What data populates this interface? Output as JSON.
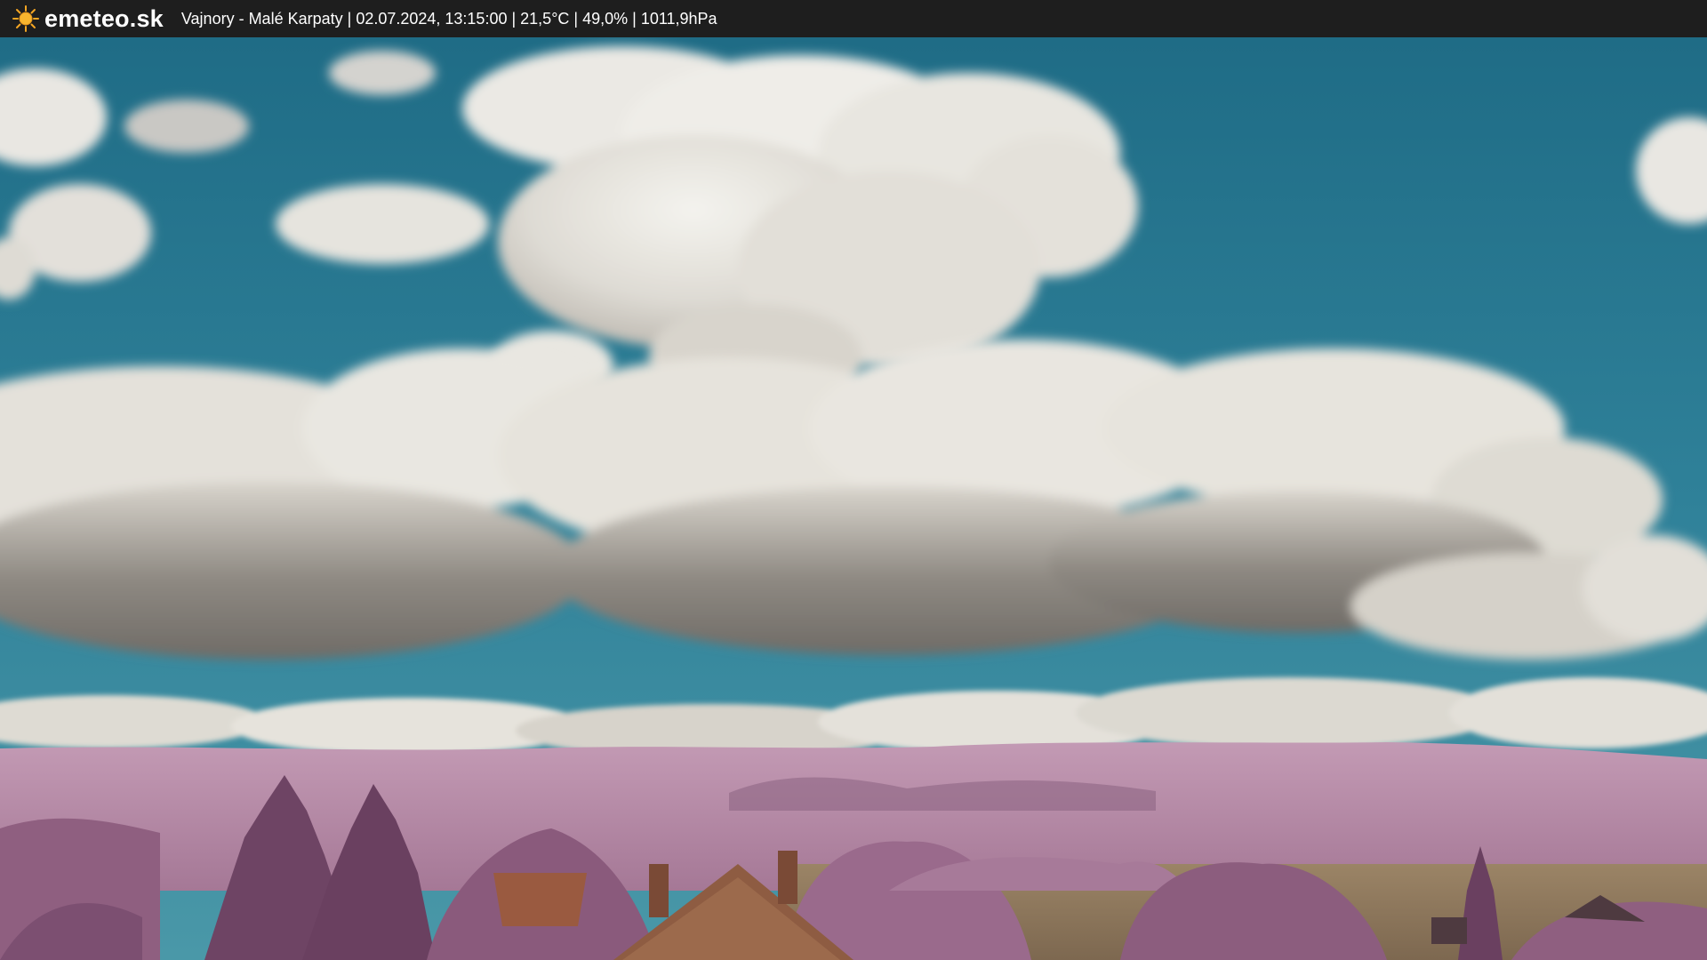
{
  "header": {
    "logo_text": "emeteo.sk",
    "location": "Vajnory - Malé Karpaty",
    "datetime": "02.07.2024, 13:15:00",
    "temperature": "21,5°C",
    "humidity": "49,0%",
    "pressure": "1011,9hPa",
    "separator": " | "
  },
  "colors": {
    "bar_background": "#1e1e1e",
    "sun": "#f5a623",
    "sky": "#2f7f96",
    "cloud": "#ecebe6",
    "cloud_shadow": "#7a7670",
    "hills": "#b48aa6",
    "trees": "#8a5a7c",
    "roof": "#9a5a40",
    "field": "#8a7358"
  },
  "icons": {
    "logo": "sun-icon"
  }
}
